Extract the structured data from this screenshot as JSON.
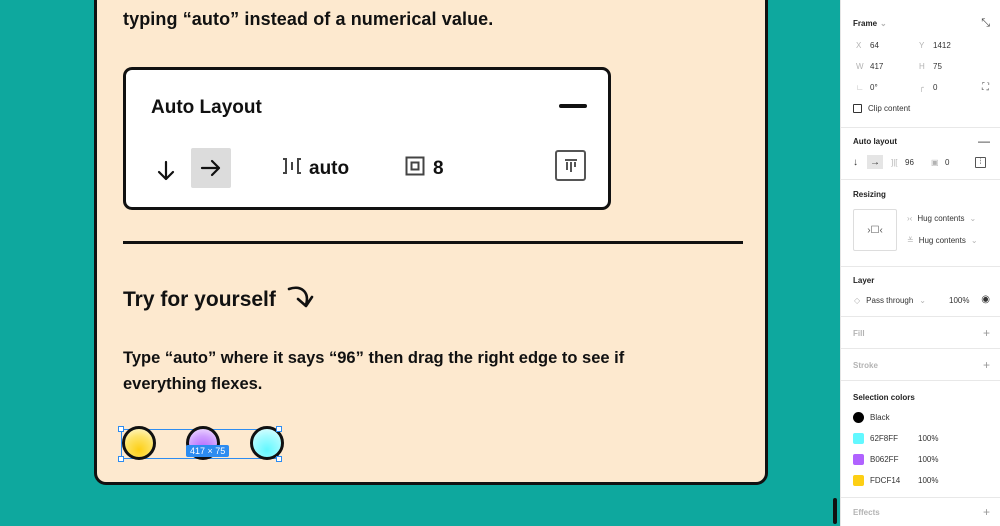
{
  "canvas": {
    "intro_text": "typing “auto” instead of a numerical value.",
    "auto_layout_title": "Auto Layout",
    "spacing_value": "auto",
    "padding_value": "8",
    "try_title": "Try for yourself",
    "instruction": "Type “auto” where it says “96” then drag the right edge to see if everything flexes.",
    "selection_size": "417 × 75"
  },
  "panel": {
    "frame": {
      "title": "Frame",
      "x_label": "X",
      "x_value": "64",
      "y_label": "Y",
      "y_value": "1412",
      "w_label": "W",
      "w_value": "417",
      "h_label": "H",
      "h_value": "75",
      "rotation_value": "0°",
      "radius_value": "0",
      "clip_label": "Clip content"
    },
    "auto_layout": {
      "title": "Auto layout",
      "spacing_value": "96",
      "padding_value": "0"
    },
    "resizing": {
      "title": "Resizing",
      "horizontal": "Hug contents",
      "vertical": "Hug contents"
    },
    "layer": {
      "title": "Layer",
      "blend": "Pass through",
      "opacity": "100%"
    },
    "fill": {
      "title": "Fill"
    },
    "stroke": {
      "title": "Stroke"
    },
    "selection_colors": {
      "title": "Selection colors",
      "items": [
        {
          "name": "Black",
          "opacity": "",
          "color": "#000000"
        },
        {
          "name": "62F8FF",
          "opacity": "100%",
          "color": "#62F8FF"
        },
        {
          "name": "B062FF",
          "opacity": "100%",
          "color": "#B062FF"
        },
        {
          "name": "FDCF14",
          "opacity": "100%",
          "color": "#FDCF14"
        }
      ]
    },
    "effects": {
      "title": "Effects"
    }
  }
}
